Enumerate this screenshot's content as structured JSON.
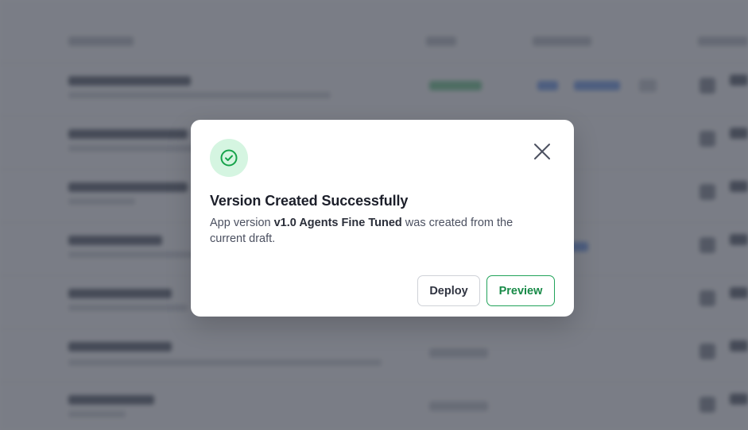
{
  "modal": {
    "title": "Version Created Successfully",
    "body_prefix": "App version ",
    "version_name": "v1.0 Agents Fine Tuned",
    "body_suffix": " was created from the current draft.",
    "deploy_label": "Deploy",
    "preview_label": "Preview",
    "icons": {
      "success": "check-circle-icon",
      "close": "close-icon"
    },
    "colors": {
      "success_bg": "#d5f5e1",
      "success_fg": "#16a34a",
      "primary_outline": "#22a35a",
      "overlay": "#1e2230"
    }
  }
}
